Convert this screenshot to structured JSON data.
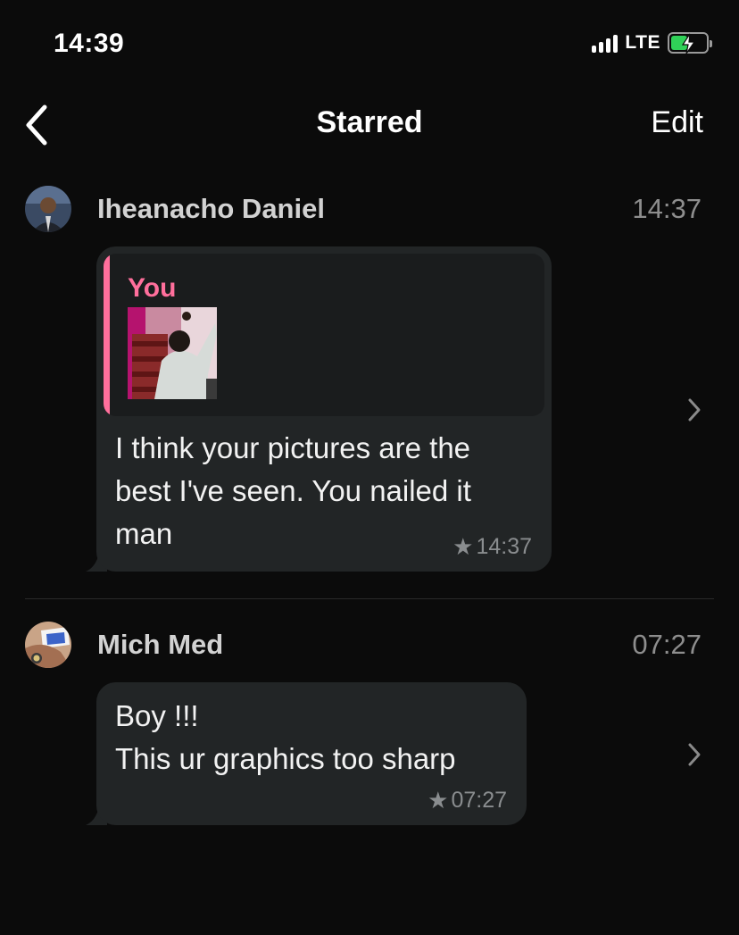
{
  "status_bar": {
    "time": "14:39",
    "network": "LTE",
    "battery_charging": true
  },
  "nav": {
    "title": "Starred",
    "edit_label": "Edit",
    "back_icon": "chevron-left-icon"
  },
  "colors": {
    "accent_quote": "#ff6f9c",
    "bubble": "#222526",
    "battery": "#30d158"
  },
  "starred_messages": [
    {
      "sender": "Iheanacho Daniel",
      "time": "14:37",
      "quote": {
        "author": "You",
        "has_thumbnail": true
      },
      "text": "I think your pictures are the\nbest I've seen. You nailed it\nman",
      "meta_time": "14:37",
      "starred": true
    },
    {
      "sender": "Mich Med",
      "time": "07:27",
      "text": "Boy !!!\nThis ur graphics too sharp",
      "meta_time": "07:27",
      "starred": true
    }
  ]
}
